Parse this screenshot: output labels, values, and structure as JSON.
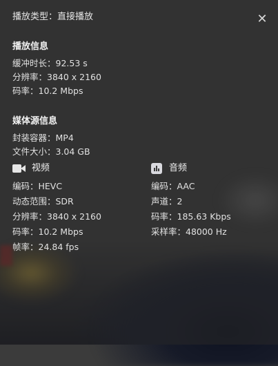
{
  "header": {
    "label": "播放类型：直接播放",
    "close_glyph": "✕"
  },
  "playback": {
    "title": "播放信息",
    "buffer": "缓冲时长：92.53 s",
    "resolution": "分辨率：3840 x 2160",
    "bitrate": "码率：10.2 Mbps"
  },
  "media_source": {
    "title": "媒体源信息",
    "container": "封装容器：MP4",
    "file_size": "文件大小：3.04 GB"
  },
  "video": {
    "heading": "视频",
    "icon": "video-camera-icon",
    "codec": "编码：HEVC",
    "dynamic_range": "动态范围：SDR",
    "resolution": "分辨率：3840 x 2160",
    "bitrate": "码率：10.2 Mbps",
    "frame_rate": "帧率：24.84 fps"
  },
  "audio": {
    "heading": "音频",
    "icon": "audio-waveform-icon",
    "codec": "编码：AAC",
    "channels": "声道：2",
    "bitrate": "码率：185.63 Kbps",
    "sample_rate": "采样率：48000 Hz"
  }
}
